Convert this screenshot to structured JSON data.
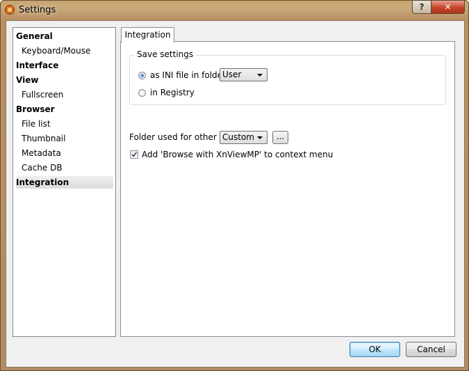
{
  "window": {
    "title": "Settings"
  },
  "titlebar": {
    "help_label": "?",
    "close_label": "✕"
  },
  "sidebar": {
    "items": [
      {
        "label": "General",
        "level": 0
      },
      {
        "label": "Keyboard/Mouse",
        "level": 1
      },
      {
        "label": "Interface",
        "level": 0
      },
      {
        "label": "View",
        "level": 0
      },
      {
        "label": "Fullscreen",
        "level": 1
      },
      {
        "label": "Browser",
        "level": 0
      },
      {
        "label": "File list",
        "level": 1
      },
      {
        "label": "Thumbnail",
        "level": 1
      },
      {
        "label": "Metadata",
        "level": 1
      },
      {
        "label": "Cache DB",
        "level": 1
      },
      {
        "label": "Integration",
        "level": 0,
        "selected": true
      }
    ]
  },
  "tabs": [
    {
      "label": "Integration",
      "active": true
    }
  ],
  "save_settings": {
    "title": "Save settings",
    "ini_option": {
      "label": "as INI file in folder",
      "checked": true
    },
    "ini_folder": {
      "value": "User"
    },
    "registry_option": {
      "label": "in Registry",
      "checked": false
    }
  },
  "other_files": {
    "label": "Folder used for other files",
    "value": "Custom",
    "browse_label": "..."
  },
  "context_menu": {
    "label": "Add 'Browse with XnViewMP' to context menu",
    "checked": true
  },
  "footer": {
    "ok_label": "OK",
    "cancel_label": "Cancel"
  }
}
